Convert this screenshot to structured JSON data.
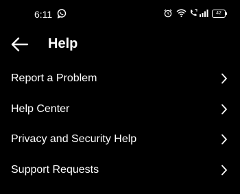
{
  "status_bar": {
    "time": "6:11",
    "battery_level": "42",
    "icons": [
      "chat-bubble-icon",
      "alarm-icon",
      "wifi-icon",
      "volte-call-icon",
      "cell-signal-icon",
      "battery-icon"
    ]
  },
  "header": {
    "title": "Help",
    "back_icon": "arrow-left-icon"
  },
  "menu": {
    "items": [
      {
        "label": "Report a Problem",
        "icon": "chevron-right-icon"
      },
      {
        "label": "Help Center",
        "icon": "chevron-right-icon"
      },
      {
        "label": "Privacy and Security Help",
        "icon": "chevron-right-icon"
      },
      {
        "label": "Support Requests",
        "icon": "chevron-right-icon"
      }
    ]
  },
  "colors": {
    "background": "#000000",
    "text": "#ffffff"
  }
}
